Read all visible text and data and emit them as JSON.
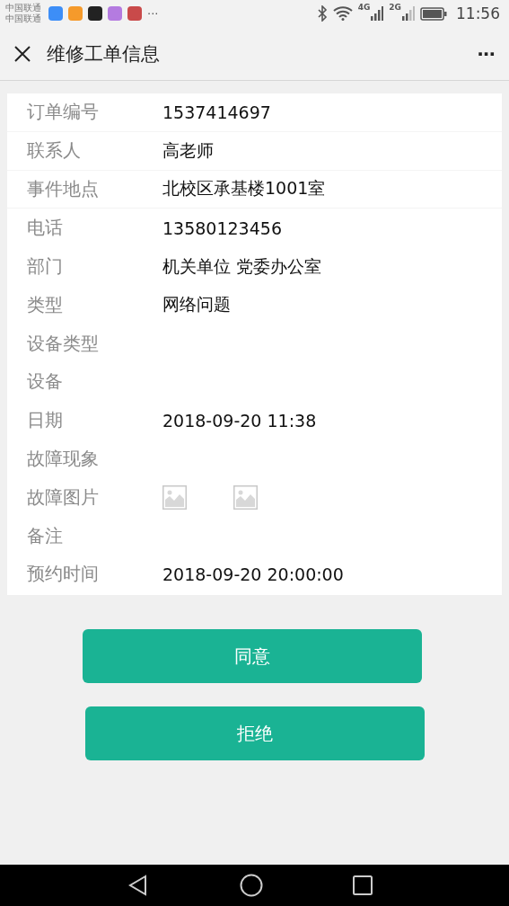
{
  "status_bar": {
    "carriers": [
      "中国联通",
      "中国联通"
    ],
    "apps": [
      {
        "color": "#3d8ef7"
      },
      {
        "color": "#f59a2b"
      },
      {
        "color": "#222222"
      },
      {
        "color": "#b47be0"
      },
      {
        "color": "#c94a4a"
      }
    ],
    "more": "···",
    "network_1": "4G",
    "network_2": "2G",
    "time": "11:56"
  },
  "header": {
    "title": "维修工单信息",
    "more": "···"
  },
  "rows": [
    {
      "kind": "text",
      "label": "订单编号",
      "value": "1537414697"
    },
    {
      "kind": "text",
      "label": "联系人",
      "value": "高老师"
    },
    {
      "kind": "text",
      "label": "事件地点",
      "value": "北校区承基楼1001室"
    },
    {
      "kind": "text",
      "label": "电话",
      "value": "13580123456"
    },
    {
      "kind": "text",
      "label": "部门",
      "value": "机关单位 党委办公室"
    },
    {
      "kind": "text",
      "label": "类型",
      "value": "网络问题"
    },
    {
      "kind": "text",
      "label": "设备类型"
    },
    {
      "kind": "text",
      "label": "设备"
    },
    {
      "kind": "text",
      "label": "日期",
      "value": "2018-09-20 11:38"
    },
    {
      "kind": "text",
      "label": "故障现象"
    },
    {
      "kind": "images",
      "label": "故障图片",
      "images": [
        {
          "kind": "placeholder"
        },
        {
          "kind": "placeholder"
        }
      ]
    },
    {
      "kind": "text",
      "label": "备注"
    },
    {
      "kind": "text",
      "label": "预约时间",
      "value": "2018-09-20 20:00:00"
    }
  ],
  "buttons": [
    "同意",
    "拒绝"
  ]
}
